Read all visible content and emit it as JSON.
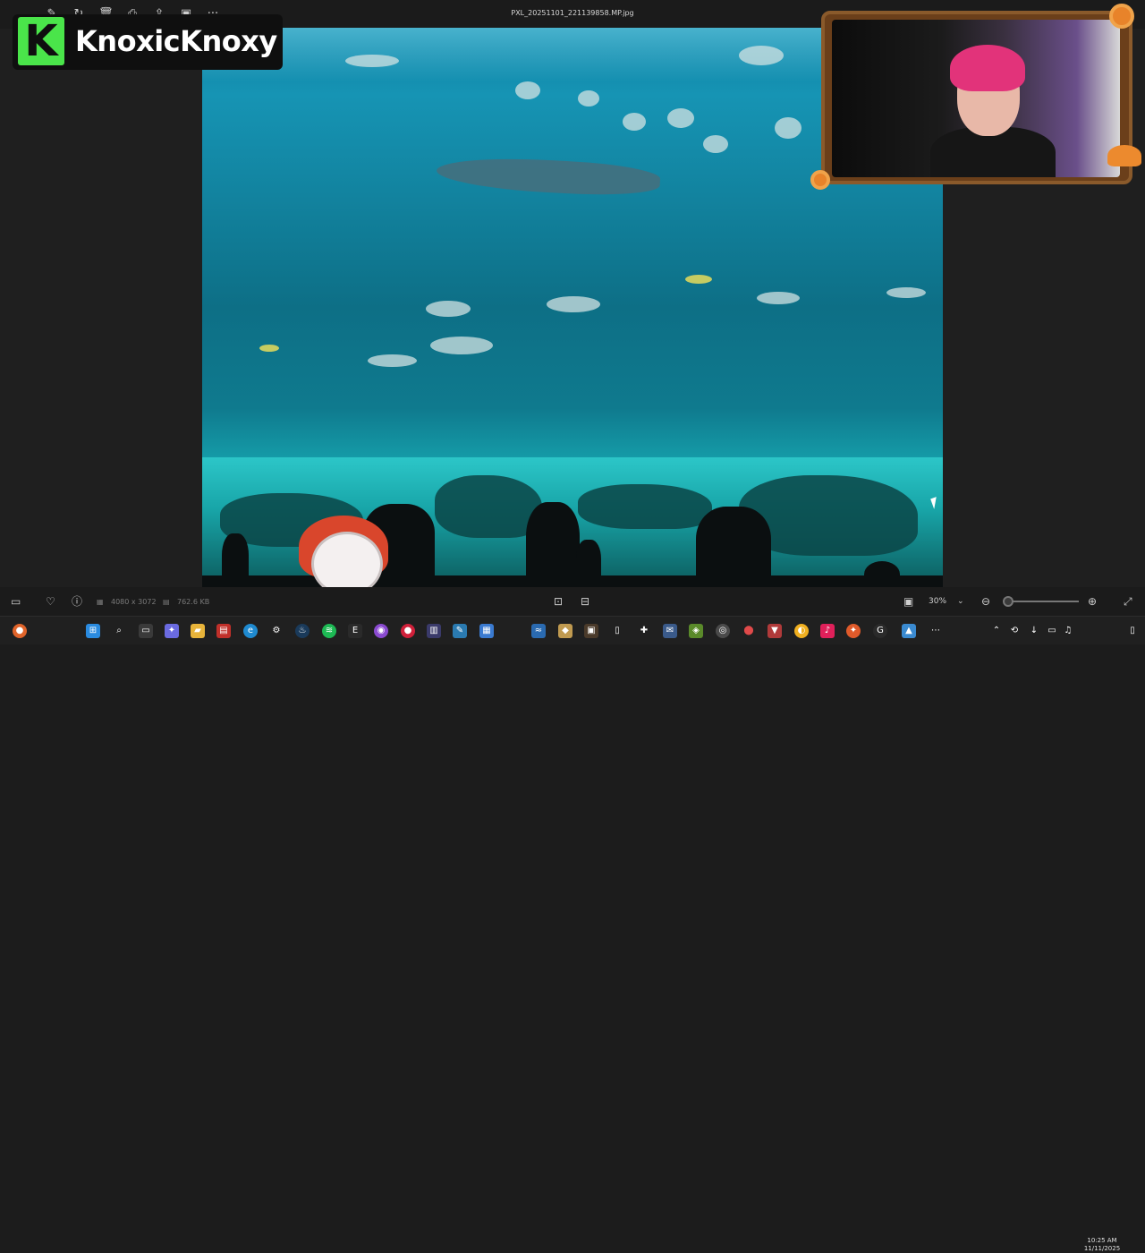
{
  "window": {
    "file_name": "PXL_20251101_221139858.MP.jpg"
  },
  "toolbar": {
    "icons": [
      "edit-icon",
      "delete-icon",
      "print-icon",
      "share-icon",
      "slideshow-icon",
      "more-icon"
    ],
    "more_label": "···"
  },
  "overlay": {
    "channel_name": "KnoxicKnoxy",
    "logo_letter": "K"
  },
  "status_bar": {
    "dimensions": "4080 x 3072",
    "file_size": "762.6 KB",
    "zoom": "30%"
  },
  "taskbar": {
    "time": "10:25 AM",
    "date": "11/11/2025"
  },
  "colors": {
    "logo_green": "#4ae54a",
    "water": "#1694b4",
    "sand": "#2cc6c8",
    "hair": "#e2337a"
  }
}
